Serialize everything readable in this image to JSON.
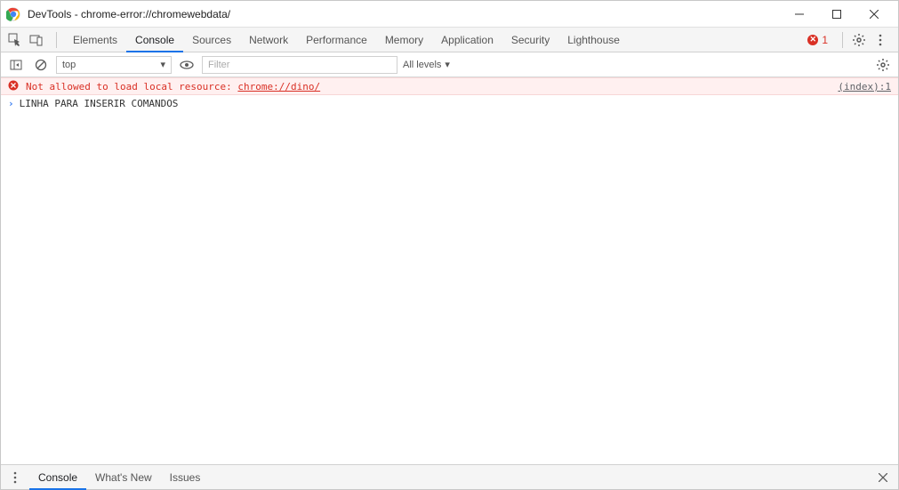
{
  "window": {
    "title": "DevTools - chrome-error://chromewebdata/"
  },
  "tabs": [
    {
      "label": "Elements",
      "selected": false
    },
    {
      "label": "Console",
      "selected": true
    },
    {
      "label": "Sources",
      "selected": false
    },
    {
      "label": "Network",
      "selected": false
    },
    {
      "label": "Performance",
      "selected": false
    },
    {
      "label": "Memory",
      "selected": false
    },
    {
      "label": "Application",
      "selected": false
    },
    {
      "label": "Security",
      "selected": false
    },
    {
      "label": "Lighthouse",
      "selected": false
    }
  ],
  "error_count": "1",
  "console_toolbar": {
    "context": "top",
    "filter_placeholder": "Filter",
    "levels_label": "All levels"
  },
  "messages": {
    "err_text": "Not allowed to load local resource: ",
    "err_link": "chrome://dino/",
    "err_source": "(index):1",
    "prompt_text": "LINHA PARA INSERIR COMANDOS"
  },
  "drawer_tabs": [
    {
      "label": "Console",
      "selected": true
    },
    {
      "label": "What's New",
      "selected": false
    },
    {
      "label": "Issues",
      "selected": false
    }
  ]
}
